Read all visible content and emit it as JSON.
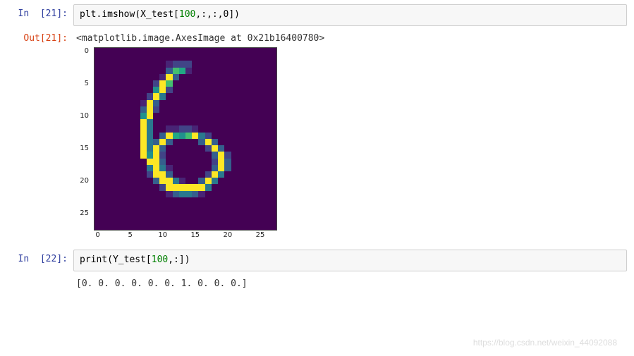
{
  "cell21": {
    "in_label": "In  [21]:",
    "code_pre": "plt.imshow(X_test[",
    "code_num": "100",
    "code_post": ",:,:,0])",
    "out_label": "Out[21]:",
    "out_text": "<matplotlib.image.AxesImage at 0x21b16400780>"
  },
  "cell22": {
    "in_label": "In  [22]:",
    "code_pre": "print(Y_test[",
    "code_num": "100",
    "code_post": ",:])",
    "out_text": "[0. 0. 0. 0. 0. 0. 1. 0. 0. 0.]"
  },
  "watermark": "https://blog.csdn.net/weixin_44092088",
  "chart_data": {
    "type": "heatmap",
    "title": "",
    "xlabel": "",
    "ylabel": "",
    "x_ticks": [
      0,
      5,
      10,
      15,
      20,
      25
    ],
    "y_ticks": [
      0,
      5,
      10,
      15,
      20,
      25
    ],
    "xlim": [
      -0.5,
      27.5
    ],
    "ylim": [
      27.5,
      -0.5
    ],
    "colormap": "viridis",
    "grid_size": [
      28,
      28
    ],
    "values": [
      "0000000000000000000000000000",
      "0000000000000000000000000000",
      "0000000000012220000000000000",
      "0000000000037610000000000000",
      "0000000000193000000000000000",
      "0000000002970000000000000000",
      "0000000005920000000000000000",
      "0000000029400000000000000000",
      "0000000193000000000000000000",
      "0000000392000000000000000000",
      "0000000590000000000000000000",
      "0000000940000000000000000000",
      "0000000940011221000000000000",
      "0000000940396579420000000000",
      "0000000943930000393000000000",
      "0000000949300000029300000000",
      "0000000959200000003920000000",
      "0000000099300000002930000000",
      "0000000049410000003930000000",
      "0000000029930000029400000000",
      "0000000003994100394000000000",
      "0000000000299999940000000000",
      "0000000000013443100000000000",
      "0000000000000000000000000000",
      "0000000000000000000000000000",
      "0000000000000000000000000000",
      "0000000000000000000000000000",
      "0000000000000000000000000000"
    ]
  }
}
